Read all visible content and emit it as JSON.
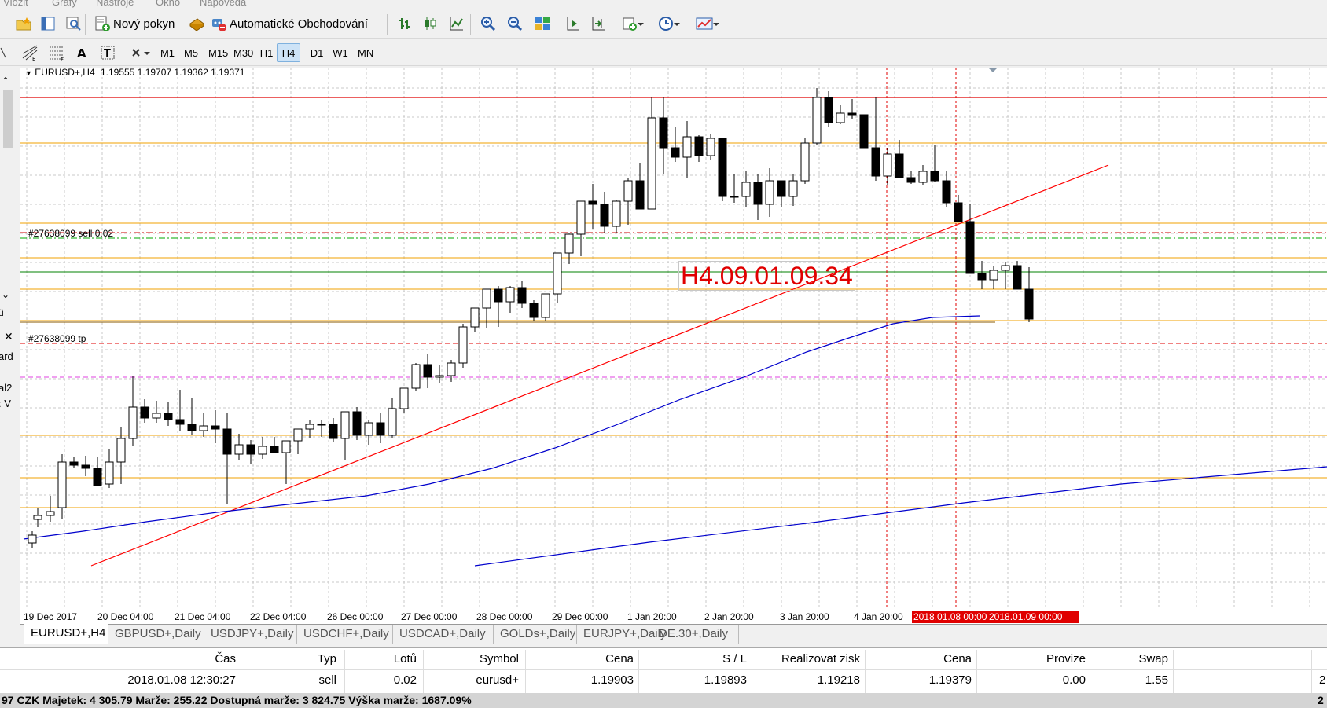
{
  "menu": {
    "items": [
      "Vložit",
      "Grafy",
      "Nástroje",
      "Okno",
      "Nápověda"
    ]
  },
  "toolbar": {
    "new_order_label": "Nový pokyn",
    "auto_trading_label": "Automatické Obchodování"
  },
  "timeframes": [
    "M1",
    "M5",
    "M15",
    "M30",
    "H1",
    "H4",
    "D1",
    "W1",
    "MN"
  ],
  "active_timeframe": "H4",
  "left_panel": {
    "fragments": [
      "ard",
      "al2",
      ": V"
    ]
  },
  "chart": {
    "header_symbol": "EURUSD+,H4",
    "header_ohlc": "1.19555 1.19707 1.19362 1.19371",
    "order_label": "#27638099 sell 0.02",
    "tp_label": "#27638099 tp",
    "text_object": "H4.09.01.09.34",
    "time_labels": [
      "19 Dec 2017",
      "20 Dec 04:00",
      "21 Dec 04:00",
      "22 Dec 04:00",
      "26 Dec 00:00",
      "27 Dec 00:00",
      "28 Dec 00:00",
      "29 Dec 00:00",
      "1 Jan 20:00",
      "2 Jan 20:00",
      "3 Jan 20:00",
      "4 Jan 20:00"
    ],
    "highlight_time_labels": [
      "2018.01.08 00:00",
      "2018.01.09 00:00"
    ],
    "colors": {
      "resistance": "#e00000",
      "level": "#f0a000",
      "ma": "#0000cc",
      "trend": "#ff0000",
      "entry": "#008000",
      "highlight_bg": "#e00000"
    }
  },
  "tabs": [
    "EURUSD+,H4",
    "GBPUSD+,Daily",
    "USDJPY+,Daily",
    "USDCHF+,Daily",
    "USDCAD+,Daily",
    "GOLDs+,Daily",
    "EURJPY+,Daily",
    "DE.30+,Daily"
  ],
  "terminal": {
    "headers": [
      "Čas",
      "Typ",
      "Lotů",
      "Symbol",
      "Cena",
      "S / L",
      "Realizovat zisk",
      "Cena",
      "Provize",
      "Swap"
    ],
    "row": [
      "2018.01.08 12:30:27",
      "sell",
      "0.02",
      "eurusd+",
      "1.19903",
      "1.19893",
      "1.19218",
      "1.19379",
      "0.00",
      "1.55"
    ],
    "right_fragment": "2",
    "right_fragment_header": "",
    "status": "97 CZK  Majetek: 4 305.79  Marže: 255.22  Dostupná marže: 3 824.75  Výška marže: 1687.09%",
    "status_right": "2"
  }
}
